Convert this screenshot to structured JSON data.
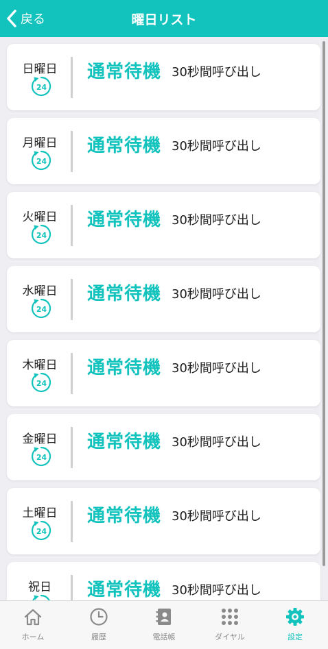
{
  "header": {
    "back_label": "戻る",
    "title": "曜日リスト"
  },
  "schedule": [
    {
      "day": "日曜日",
      "mode": "通常待機",
      "call": "30秒間呼び出し"
    },
    {
      "day": "月曜日",
      "mode": "通常待機",
      "call": "30秒間呼び出し"
    },
    {
      "day": "火曜日",
      "mode": "通常待機",
      "call": "30秒間呼び出し"
    },
    {
      "day": "水曜日",
      "mode": "通常待機",
      "call": "30秒間呼び出し"
    },
    {
      "day": "木曜日",
      "mode": "通常待機",
      "call": "30秒間呼び出し"
    },
    {
      "day": "金曜日",
      "mode": "通常待機",
      "call": "30秒間呼び出し"
    },
    {
      "day": "土曜日",
      "mode": "通常待機",
      "call": "30秒間呼び出し"
    },
    {
      "day": "祝日",
      "mode": "通常待機",
      "call": "30秒間呼び出し"
    }
  ],
  "cycle_icon_text": "24",
  "tabs": [
    {
      "label": "ホーム",
      "icon": "home-icon"
    },
    {
      "label": "履歴",
      "icon": "clock-icon"
    },
    {
      "label": "電話帳",
      "icon": "contacts-book-icon"
    },
    {
      "label": "ダイヤル",
      "icon": "dialpad-icon"
    },
    {
      "label": "設定",
      "icon": "gear-icon",
      "active": true
    }
  ],
  "colors": {
    "accent": "#12c3bd",
    "inactive": "#888888",
    "background": "#eeeef3"
  }
}
